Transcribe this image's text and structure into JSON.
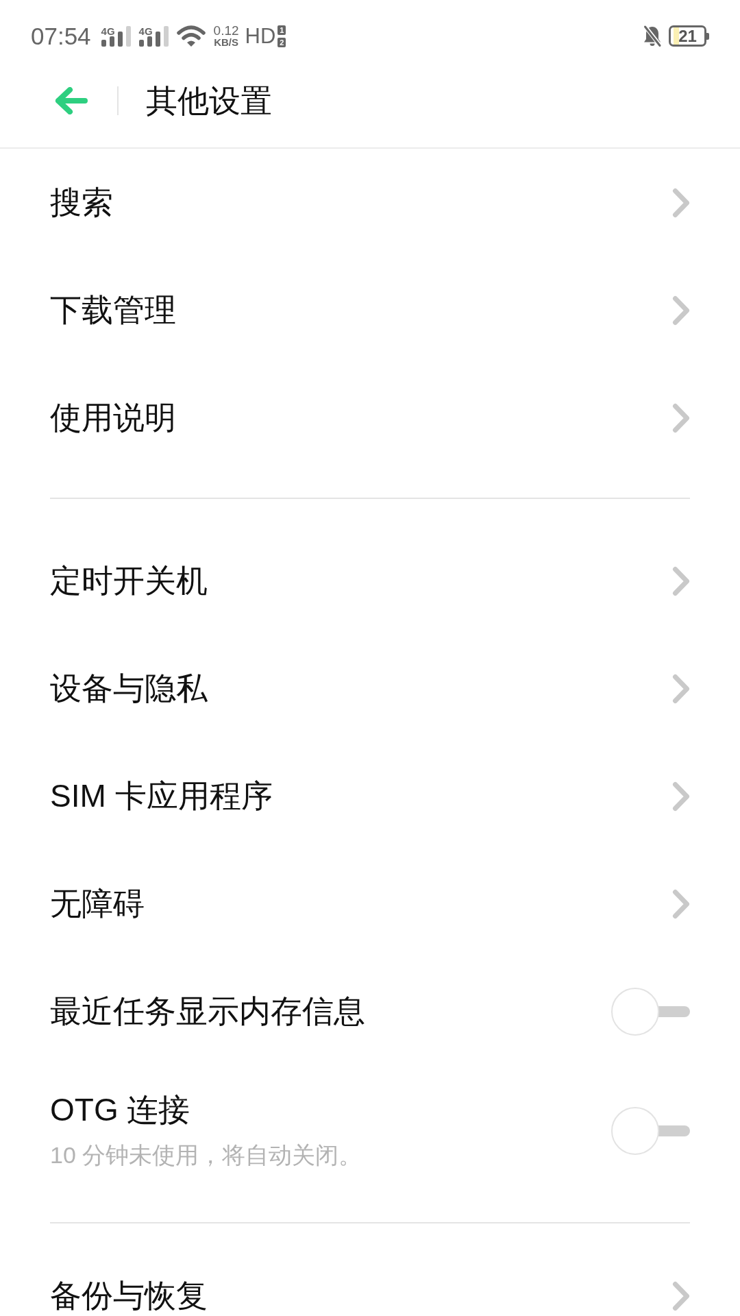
{
  "status_bar": {
    "time": "07:54",
    "signals": [
      {
        "network": "4G"
      },
      {
        "network": "4G"
      }
    ],
    "speed": {
      "value": "0.12",
      "unit": "KB/S"
    },
    "hd": {
      "label": "HD",
      "sims": [
        "1",
        "2"
      ]
    },
    "battery": "21"
  },
  "header": {
    "title": "其他设置"
  },
  "groups": [
    {
      "items": [
        {
          "kind": "link",
          "label": "搜索"
        },
        {
          "kind": "link",
          "label": "下载管理"
        },
        {
          "kind": "link",
          "label": "使用说明"
        }
      ]
    },
    {
      "items": [
        {
          "kind": "link",
          "label": "定时开关机"
        },
        {
          "kind": "link",
          "label": "设备与隐私"
        },
        {
          "kind": "link",
          "label": "SIM 卡应用程序"
        },
        {
          "kind": "link",
          "label": "无障碍"
        },
        {
          "kind": "toggle",
          "label": "最近任务显示内存信息",
          "on": false
        },
        {
          "kind": "toggle",
          "label": "OTG 连接",
          "subtitle": "10 分钟未使用，将自动关闭。",
          "on": false
        }
      ]
    },
    {
      "items": [
        {
          "kind": "link",
          "label": "备份与恢复"
        }
      ]
    }
  ]
}
